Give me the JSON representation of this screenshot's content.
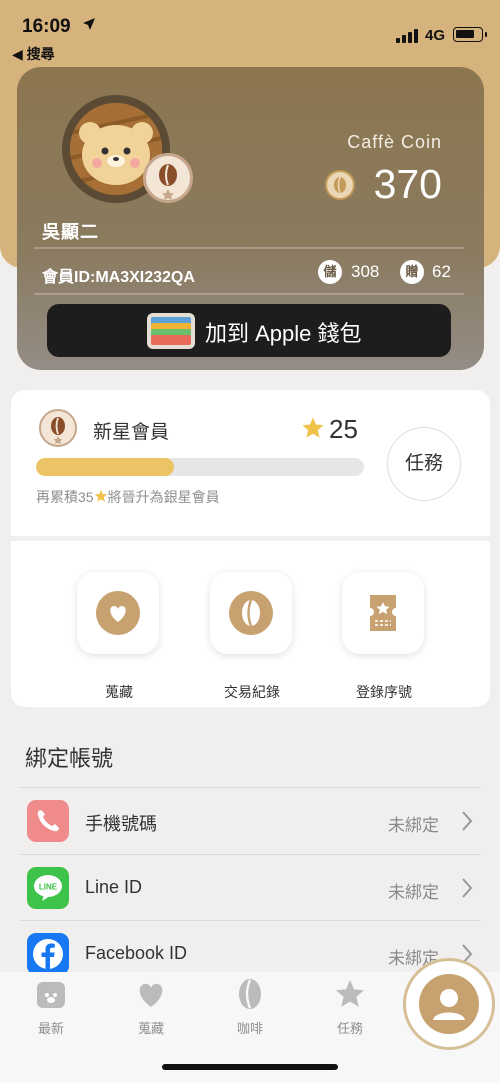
{
  "status_bar": {
    "time": "16:09",
    "network": "4G",
    "back_label": "◀ 搜尋"
  },
  "card": {
    "member_name": "吳顯二",
    "coin_label": "Caffè Coin",
    "coin_value": "370",
    "member_id": "會員ID:MA3XI232QA",
    "stored_icon": "儲",
    "stored_points": "308",
    "gift_icon": "贈",
    "gift_points": "62",
    "wallet_label": "加到 Apple 錢包"
  },
  "level": {
    "name": "新星會員",
    "stars": "25",
    "progress": 0.42,
    "hint_pre": "再累積35",
    "hint_post": "將晉升為銀星會員",
    "task_label": "任務"
  },
  "actions": [
    {
      "label": "蒐藏",
      "icon": "heart-icon"
    },
    {
      "label": "交易紀錄",
      "icon": "coffee-bean-icon"
    },
    {
      "label": "登錄序號",
      "icon": "ticket-icon"
    }
  ],
  "bind": {
    "title": "綁定帳號",
    "rows": [
      {
        "label": "手機號碼",
        "status": "未綁定",
        "icon": "phone-icon",
        "color": "#f08b8b"
      },
      {
        "label": "Line ID",
        "status": "未綁定",
        "icon": "line-icon",
        "color": "#3dc24a"
      },
      {
        "label": "Facebook ID",
        "status": "未綁定",
        "icon": "facebook-icon",
        "color": "#1877f2"
      }
    ]
  },
  "tabbar": {
    "items": [
      {
        "label": "最新",
        "icon": "bear-icon"
      },
      {
        "label": "蒐藏",
        "icon": "heart-icon"
      },
      {
        "label": "咖啡",
        "icon": "coffee-bean-icon"
      },
      {
        "label": "任務",
        "icon": "star-icon"
      }
    ],
    "active_icon": "profile-icon"
  },
  "colors": {
    "gold": "#d6b27c",
    "accent": "#c8a170",
    "progress": "#ecc466",
    "star": "#f1c24a"
  }
}
